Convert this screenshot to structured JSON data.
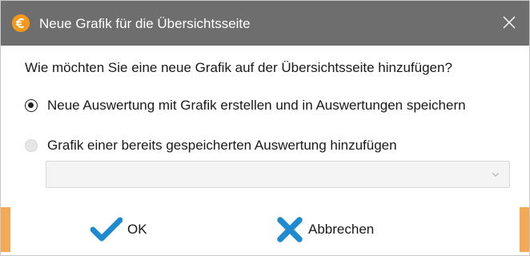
{
  "window": {
    "title": "Neue Grafik für die Übersichtsseite",
    "app_icon": "euro-icon",
    "close_icon": "close-icon"
  },
  "main": {
    "question": "Wie möchten Sie eine neue Grafik auf der Übersichtsseite hinzufügen?",
    "options": [
      {
        "label": "Neue Auswertung mit Grafik erstellen und in Auswertungen speichern",
        "selected": true,
        "enabled": true
      },
      {
        "label": "Grafik einer bereits gespeicherten Auswertung hinzufügen",
        "selected": false,
        "enabled": false
      }
    ],
    "saved_report_select": {
      "value": "",
      "enabled": false
    }
  },
  "footer": {
    "ok_label": "OK",
    "ok_icon": "checkmark-icon",
    "cancel_label": "Abbrechen",
    "cancel_icon": "x-icon"
  },
  "colors": {
    "titlebar": "#6e6e6e",
    "accent_orange": "#f39a1c",
    "button_side_bars": "#f5a856",
    "ok_blue": "#1e8bd1",
    "cancel_blue": "#1e8bd1"
  }
}
